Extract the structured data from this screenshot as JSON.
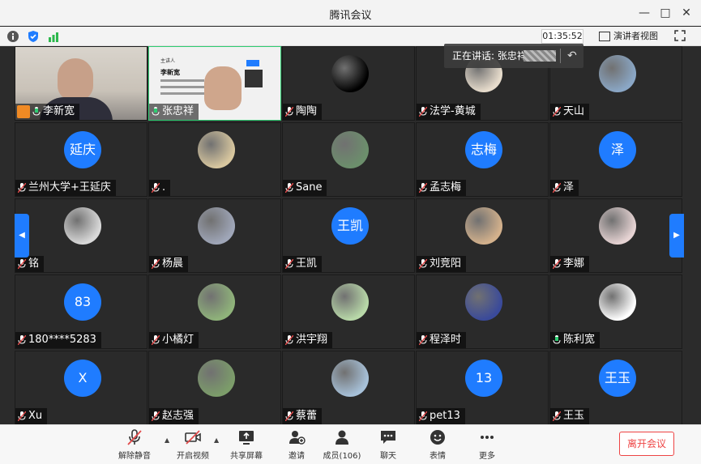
{
  "window": {
    "title": "腾讯会议"
  },
  "infobar": {
    "timer": "01:35:52",
    "presenter_view": "演讲者视图"
  },
  "speaking": {
    "label": "正在讲话: 张忠祥;"
  },
  "tiles": [
    {
      "name": "李新宽",
      "kind": "video"
    },
    {
      "name": "张忠祥",
      "kind": "video-slide",
      "slide_title": "主讲人",
      "slide_name": "李新宽"
    },
    {
      "name": "陶陶",
      "kind": "image"
    },
    {
      "name": "法学-黄城",
      "kind": "image"
    },
    {
      "name": "天山",
      "kind": "image"
    },
    {
      "name": "兰州大学+王延庆",
      "kind": "text",
      "avatar": "延庆"
    },
    {
      "name": ".",
      "kind": "image"
    },
    {
      "name": "Sane",
      "kind": "image"
    },
    {
      "name": "孟志梅",
      "kind": "text",
      "avatar": "志梅"
    },
    {
      "name": "泽",
      "kind": "text",
      "avatar": "泽"
    },
    {
      "name": "铭",
      "kind": "image"
    },
    {
      "name": "杨晨",
      "kind": "image"
    },
    {
      "name": "王凯",
      "kind": "text",
      "avatar": "王凯"
    },
    {
      "name": "刘竞阳",
      "kind": "image"
    },
    {
      "name": "李娜",
      "kind": "image"
    },
    {
      "name": "180****5283",
      "kind": "text",
      "avatar": "83"
    },
    {
      "name": "小橘灯",
      "kind": "image"
    },
    {
      "name": "洪宇翔",
      "kind": "image"
    },
    {
      "name": "程泽时",
      "kind": "image"
    },
    {
      "name": "陈利宽",
      "kind": "image"
    },
    {
      "name": "Xu",
      "kind": "text",
      "avatar": "X"
    },
    {
      "name": "赵志强",
      "kind": "image"
    },
    {
      "name": "蔡蕾",
      "kind": "image"
    },
    {
      "name": "pet13",
      "kind": "text",
      "avatar": "13"
    },
    {
      "name": "王玉",
      "kind": "text",
      "avatar": "王玉"
    }
  ],
  "toolbar": {
    "unmute": "解除静音",
    "video": "开启视频",
    "share": "共享屏幕",
    "invite": "邀请",
    "members": "成员(106)",
    "chat": "聊天",
    "emoji": "表情",
    "more": "更多",
    "leave": "离开会议"
  },
  "colors": {
    "accent": "#1f7cff",
    "leave": "#e44444",
    "muted": "#e24a4a"
  }
}
